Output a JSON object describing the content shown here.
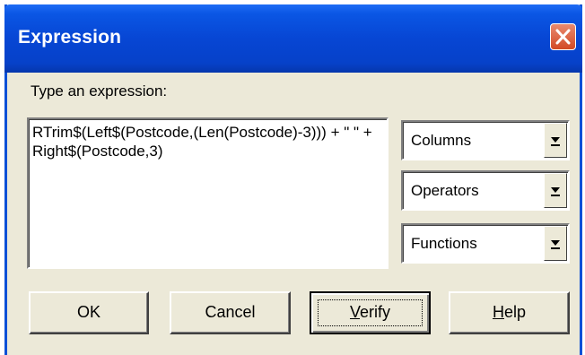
{
  "window": {
    "title": "Expression"
  },
  "prompt_label": "Type an expression:",
  "expression": {
    "text": "RTrim$(Left$(Postcode,(Len(Postcode)-3))) + \" \" + Right$(Postcode,3)"
  },
  "combos": {
    "columns": "Columns",
    "operators": "Operators",
    "functions": "Functions"
  },
  "buttons": {
    "ok": "OK",
    "cancel": "Cancel",
    "verify_mnemonic": "V",
    "verify_rest": "erify",
    "help_mnemonic": "H",
    "help_rest": "elp"
  },
  "icons": {
    "close": "close-icon",
    "dropdown": "dropdown-arrow-icon"
  },
  "colors": {
    "titlebar": "#0746d4",
    "close_button": "#d24a25",
    "dialog_face": "#ece9d8"
  }
}
